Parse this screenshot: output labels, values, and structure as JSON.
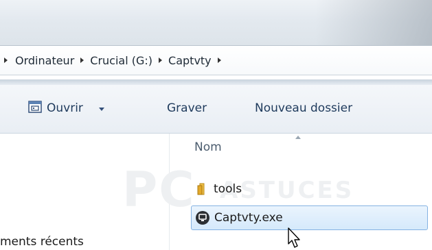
{
  "breadcrumb": {
    "items": [
      "Ordinateur",
      "Crucial (G:)",
      "Captvty"
    ]
  },
  "toolbar": {
    "open_label": "Ouvrir",
    "burn_label": "Graver",
    "new_folder_label": "Nouveau dossier"
  },
  "file_list": {
    "column_name": "Nom",
    "files": [
      {
        "name": "tools",
        "icon": "folder-icon",
        "selected": false
      },
      {
        "name": "Captvty.exe",
        "icon": "exe-icon",
        "selected": true
      }
    ]
  },
  "nav_pane": {
    "recent_label": "ments récents"
  },
  "watermark": {
    "text": "PC",
    "subtext": "ASTUCES"
  },
  "colors": {
    "selection": "#d5e9fb",
    "selection_border": "#84b2e2",
    "toolbar_text": "#1e3a5c"
  }
}
